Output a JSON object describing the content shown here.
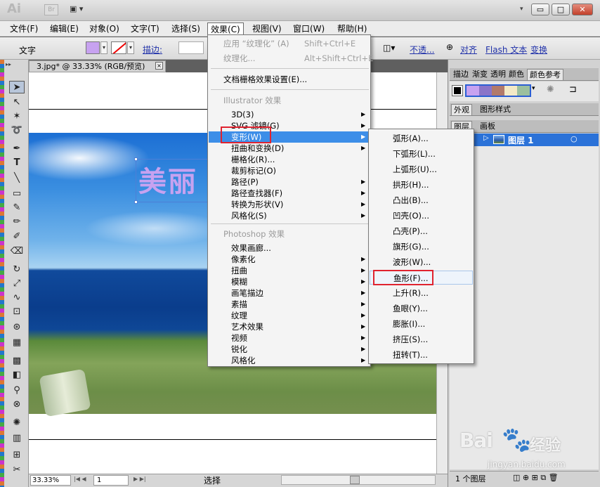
{
  "titlebar": {
    "app_logo": "Ai",
    "bridge": "Br",
    "arrange_icon": "arrange-documents-icon",
    "dropdown": "▾",
    "controls": [
      "▭",
      "□",
      "✕"
    ]
  },
  "menubar": {
    "items": [
      "文件(F)",
      "编辑(E)",
      "对象(O)",
      "文字(T)",
      "选择(S)",
      "效果(C)",
      "视图(V)",
      "窗口(W)",
      "帮助(H)"
    ]
  },
  "controlbar": {
    "label": "文字",
    "stroke_label": "描边:",
    "opacity_label": "不透...",
    "align": "对齐",
    "flash_text": "Flash 文本",
    "transform": "变换"
  },
  "document": {
    "tab_title": "3.jpg* @ 33.33% (RGB/预览)",
    "tab_close": "×",
    "art_text": "美丽"
  },
  "statusbar": {
    "zoom": "33.33%",
    "page": "1",
    "status": "选择"
  },
  "panels": {
    "tabs_top": [
      "描边",
      "渐变",
      "透明",
      "颜色",
      "颜色参考"
    ],
    "tabs_mid": [
      "外观",
      "图形样式"
    ],
    "tabs_layers": [
      "图层",
      "画板"
    ],
    "layer_name": "图层 1",
    "footer": "1 个图层"
  },
  "effect_menu": {
    "apply_last": "应用 “纹理化” (A)",
    "apply_last_shortcut": "Shift+Ctrl+E",
    "last": "纹理化...",
    "last_shortcut": "Alt+Shift+Ctrl+E",
    "doc_raster": "文档栅格效果设置(E)...",
    "illustrator_header": "Illustrator 效果",
    "illustrator_items": [
      {
        "label": "3D(3)",
        "sub": true
      },
      {
        "label": "SVG 滤镜(G)",
        "sub": true
      },
      {
        "label": "变形(W)",
        "sub": true
      },
      {
        "label": "扭曲和变换(D)",
        "sub": true
      },
      {
        "label": "栅格化(R)...",
        "sub": false
      },
      {
        "label": "裁剪标记(O)",
        "sub": false
      },
      {
        "label": "路径(P)",
        "sub": true
      },
      {
        "label": "路径查找器(F)",
        "sub": true
      },
      {
        "label": "转换为形状(V)",
        "sub": true
      },
      {
        "label": "风格化(S)",
        "sub": true
      }
    ],
    "photoshop_header": "Photoshop 效果",
    "photoshop_items": [
      {
        "label": "效果画廊...",
        "sub": false
      },
      {
        "label": "像素化",
        "sub": true
      },
      {
        "label": "扭曲",
        "sub": true
      },
      {
        "label": "模糊",
        "sub": true
      },
      {
        "label": "画笔描边",
        "sub": true
      },
      {
        "label": "素描",
        "sub": true
      },
      {
        "label": "纹理",
        "sub": true
      },
      {
        "label": "艺术效果",
        "sub": true
      },
      {
        "label": "视频",
        "sub": true
      },
      {
        "label": "锐化",
        "sub": true
      },
      {
        "label": "风格化",
        "sub": true
      }
    ]
  },
  "warp_menu": {
    "items": [
      "弧形(A)...",
      "下弧形(L)...",
      "上弧形(U)...",
      "拱形(H)...",
      "凸出(B)...",
      "凹壳(O)...",
      "凸壳(P)...",
      "旗形(G)...",
      "波形(W)...",
      "鱼形(F)...",
      "上升(R)...",
      "鱼眼(Y)...",
      "膨胀(I)...",
      "挤压(S)...",
      "扭转(T)..."
    ]
  },
  "watermark": {
    "logo": "Bai",
    "logo_du": "du",
    "cn": "经验",
    "url": "jingyan.baidu.com"
  },
  "colors": {
    "accent_highlight": "#3d8ee8",
    "annotation_red": "#e0232f",
    "text_fill": "#c7a2f0"
  }
}
